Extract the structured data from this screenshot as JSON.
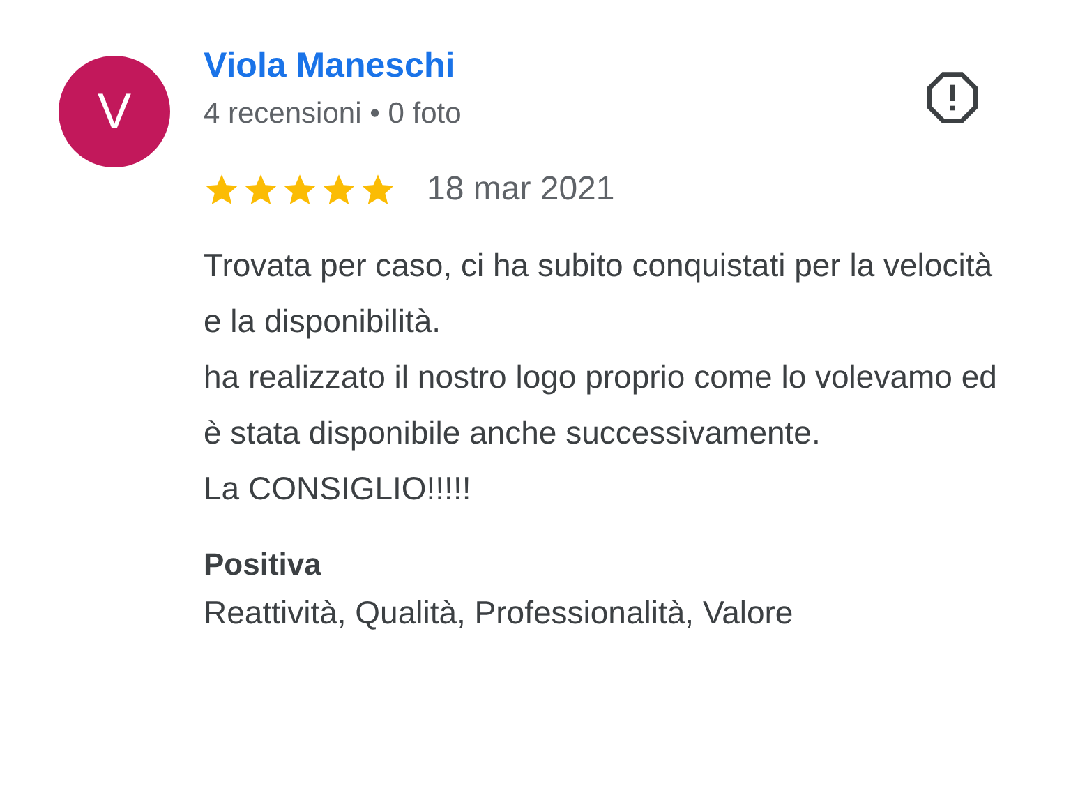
{
  "author": {
    "initial": "V",
    "color": "#c2185b",
    "name": "Viola Maneschi",
    "stats": "4 recensioni • 0 foto"
  },
  "review": {
    "stars": 5,
    "date": "18 mar 2021",
    "text": "Trovata per caso, ci ha subito conquistati per la velocità e la disponibilità.\nha realizzato il nostro logo proprio come lo volevamo ed è stata disponibile anche successivamente.\nLa CONSIGLIO!!!!!"
  },
  "attributes": [
    {
      "title": "Positiva",
      "value": "Reattività, Qualità, Professionalità, Valore"
    }
  ]
}
